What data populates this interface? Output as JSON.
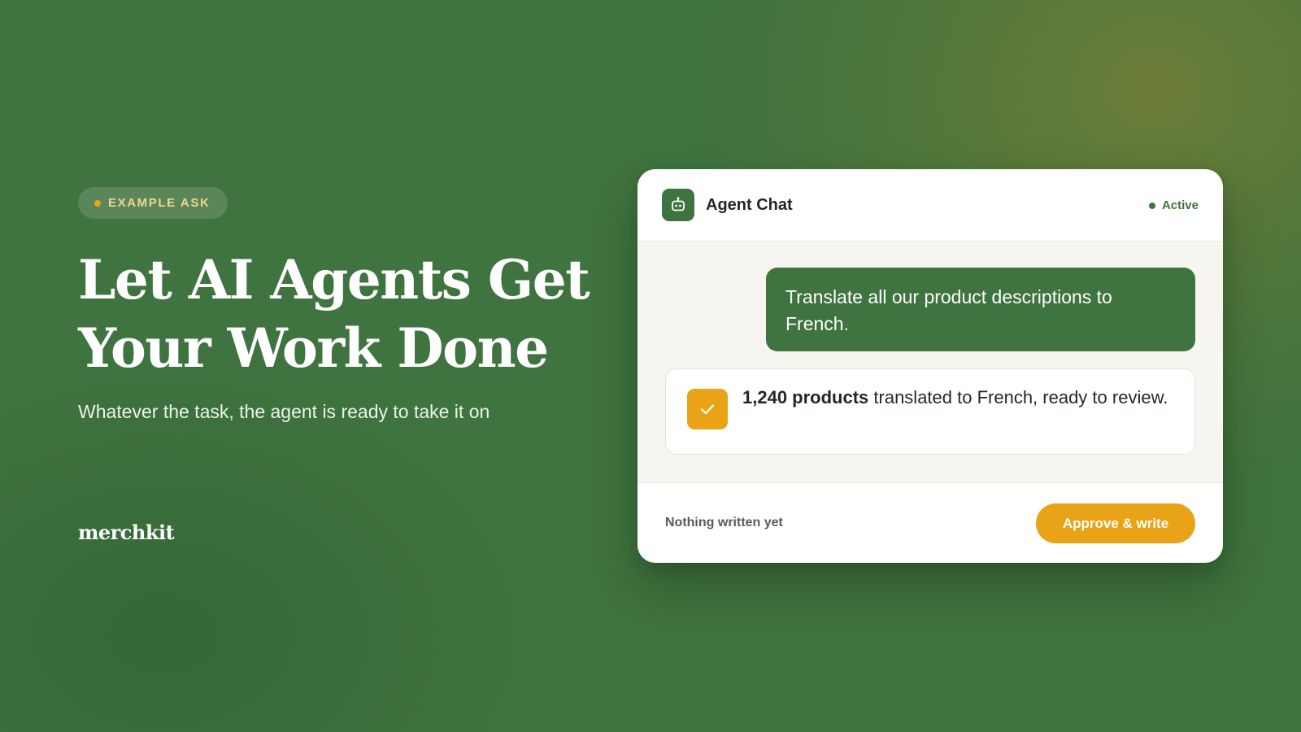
{
  "hero": {
    "badge_label": "EXAMPLE ASK",
    "headline_line1": "Let AI Agents Get",
    "headline_line2": "Your Work Done",
    "subhead": "Whatever the task, the agent is ready to take it on",
    "logo": "merchkit"
  },
  "chat": {
    "title": "Agent Chat",
    "icon": "robot-icon",
    "status": "Active",
    "user_message": "Translate all our product descriptions to French.",
    "agent_message": {
      "icon": "check-icon",
      "highlight": "1,240 products",
      "text": " translated to French, ready to review."
    },
    "footer_note": "Nothing written yet",
    "approve_label": "Approve & write"
  },
  "colors": {
    "brand_green": "#3f733f",
    "accent_gold": "#e8a317",
    "badge_text": "#f0d78a"
  }
}
